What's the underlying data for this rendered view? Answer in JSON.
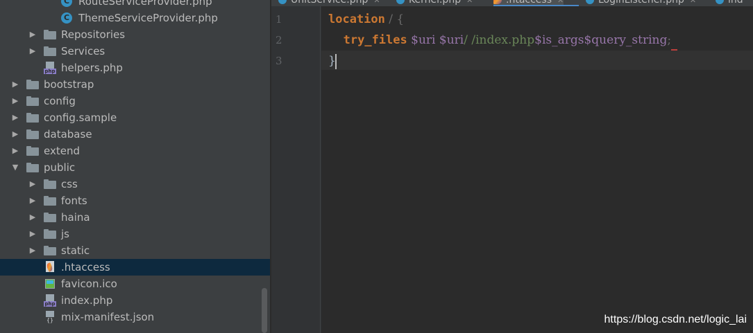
{
  "project_tree": {
    "items": [
      {
        "label": "RouteServiceProvider.php",
        "type": "class"
      },
      {
        "label": "ThemeServiceProvider.php",
        "type": "class"
      },
      {
        "label": "Repositories",
        "type": "folder"
      },
      {
        "label": "Services",
        "type": "folder"
      },
      {
        "label": "helpers.php",
        "type": "php"
      },
      {
        "label": "bootstrap",
        "type": "folder"
      },
      {
        "label": "config",
        "type": "folder"
      },
      {
        "label": "config.sample",
        "type": "folder"
      },
      {
        "label": "database",
        "type": "folder"
      },
      {
        "label": "extend",
        "type": "folder"
      },
      {
        "label": "public",
        "type": "folder",
        "expanded": true
      },
      {
        "label": "css",
        "type": "folder"
      },
      {
        "label": "fonts",
        "type": "folder"
      },
      {
        "label": "haina",
        "type": "folder"
      },
      {
        "label": "js",
        "type": "folder"
      },
      {
        "label": "static",
        "type": "folder"
      },
      {
        "label": ".htaccess",
        "type": "htaccess",
        "selected": true
      },
      {
        "label": "favicon.ico",
        "type": "ico"
      },
      {
        "label": "index.php",
        "type": "php"
      },
      {
        "label": "mix-manifest.json",
        "type": "json"
      }
    ],
    "php_tag": "php",
    "json_tag": "{}",
    "class_glyph": "C"
  },
  "tabs": [
    {
      "label": "UnitService.php",
      "icon": "class-icon"
    },
    {
      "label": "Kernel.php",
      "icon": "class-icon"
    },
    {
      "label": ".htaccess",
      "icon": "htaccess-icon",
      "active": true
    },
    {
      "label": "LoginListener.php",
      "icon": "class-icon"
    },
    {
      "label": "ind",
      "icon": "class-icon"
    }
  ],
  "editor": {
    "line_numbers": [
      "1",
      "2",
      "3"
    ],
    "line1": {
      "keyword": "location",
      "rest": " / {"
    },
    "line2": {
      "indent": "    ",
      "keyword": "try_files",
      "var1": "$uri",
      "var2": "$uri",
      "path1": "/ /index.php",
      "var3": "$is_args",
      "var4": "$query_string",
      "semi": ";"
    },
    "line3": {
      "brace": "}"
    }
  },
  "watermark": "https://blog.csdn.net/logic_lai",
  "colors": {
    "sidebar_bg": "#3c3f41",
    "editor_bg": "#2b2b2b",
    "selection": "#0d293e",
    "keyword": "#cc7832",
    "variable": "#9876aa",
    "string": "#6a8759"
  }
}
